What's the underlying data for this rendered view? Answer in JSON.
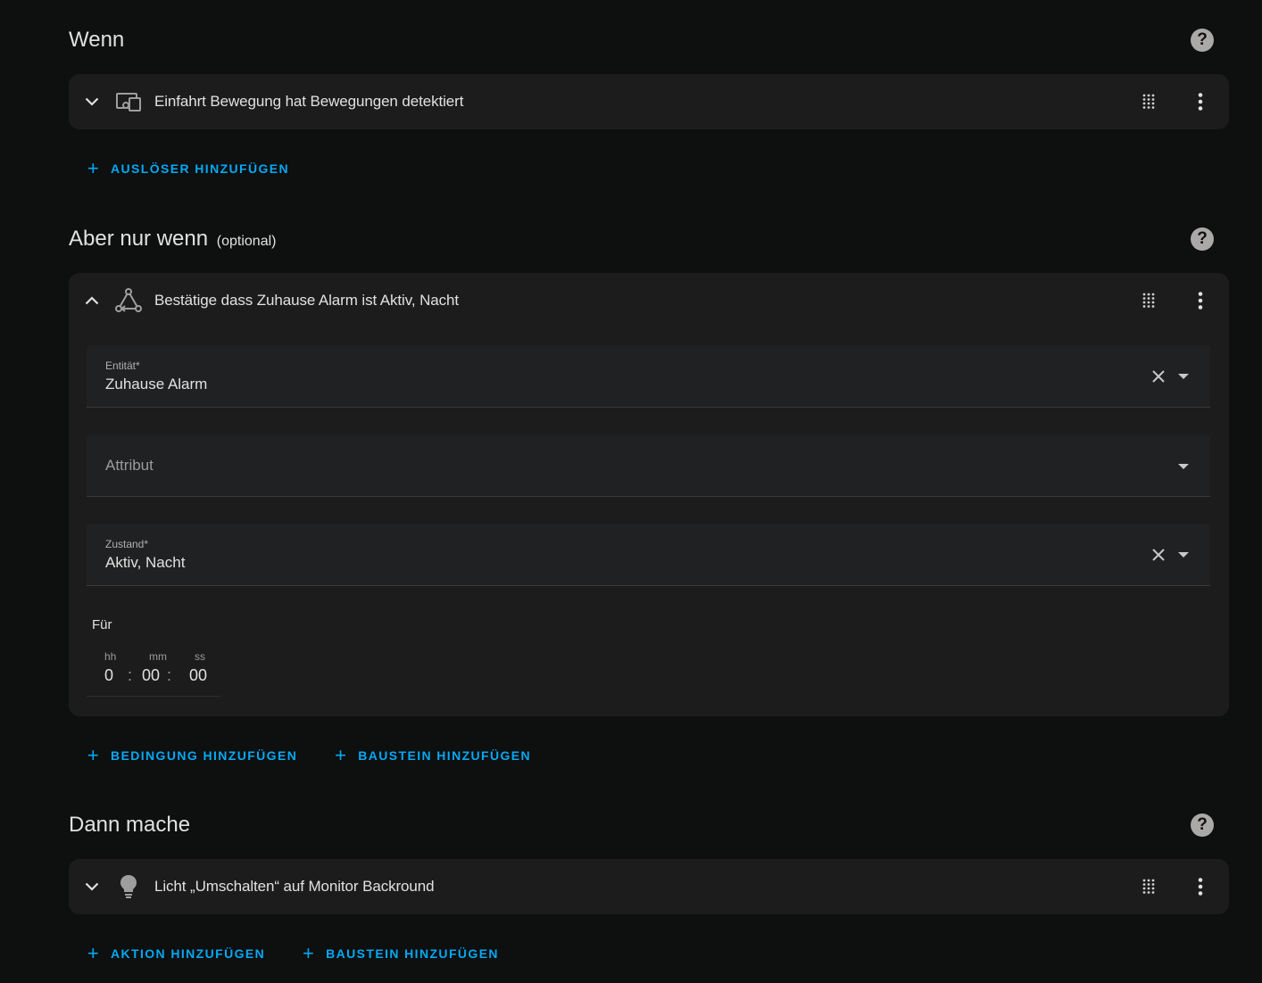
{
  "wenn": {
    "title": "Wenn",
    "trigger": {
      "label": "Einfahrt Bewegung hat Bewegungen detektiert",
      "icon": "devices-icon"
    },
    "add_trigger_label": "AUSLÖSER HINZUFÜGEN"
  },
  "aber": {
    "title": "Aber nur wenn",
    "optional": "(optional)",
    "condition": {
      "label": "Bestätige dass Zuhause Alarm ist Aktiv, Nacht",
      "icon": "state-graph-icon"
    },
    "entity_field": {
      "label": "Entität*",
      "value": "Zuhause Alarm"
    },
    "attribute_field": {
      "placeholder": "Attribut"
    },
    "state_field": {
      "label": "Zustand*",
      "value": "Aktiv, Nacht"
    },
    "for_label": "Für",
    "duration": {
      "hh_label": "hh",
      "mm_label": "mm",
      "ss_label": "ss",
      "hh": "0",
      "mm": "00",
      "ss": "00",
      "sep": ":"
    },
    "add_condition_label": "BEDINGUNG HINZUFÜGEN",
    "add_block_label": "BAUSTEIN HINZUFÜGEN"
  },
  "dann": {
    "title": "Dann mache",
    "action": {
      "label": "Licht „Umschalten“ auf Monitor Backround",
      "icon": "lightbulb-icon"
    },
    "add_action_label": "AKTION HINZUFÜGEN",
    "add_block_label": "BAUSTEIN HINZUFÜGEN"
  },
  "help_symbol": "?",
  "plus_symbol": "+",
  "colors": {
    "background": "#0e0f0f",
    "card": "#1c1c1c",
    "accent": "#03a9f4",
    "text": "#e1e1e1"
  }
}
